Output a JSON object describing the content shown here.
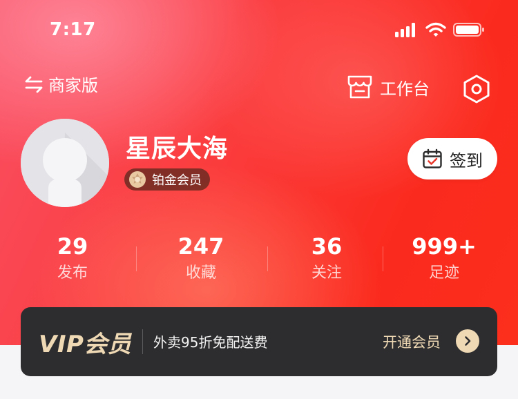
{
  "status_bar": {
    "time": "7:17",
    "icons": [
      "signal-icon",
      "wifi-icon",
      "battery-icon"
    ]
  },
  "top_bar": {
    "switch_label": "商家版",
    "workbench_label": "工作台",
    "icons": [
      "swap-icon",
      "store-icon",
      "settings-icon"
    ]
  },
  "profile": {
    "username": "星辰大海",
    "member_level": "铂金会员",
    "checkin_label": "签到"
  },
  "stats": [
    {
      "value": "29",
      "label": "发布"
    },
    {
      "value": "247",
      "label": "收藏"
    },
    {
      "value": "36",
      "label": "关注"
    },
    {
      "value": "999+",
      "label": "足迹"
    }
  ],
  "vip_card": {
    "title": "VIP会员",
    "description": "外卖95折免配送费",
    "action_label": "开通会员"
  },
  "colors": {
    "hero_red": "#fb3b3b",
    "hero_pink": "#fa4f63",
    "vip_gold": "#efd9b4",
    "vip_bg": "#2d2d2f",
    "checkin_accent": "#e8392c"
  }
}
